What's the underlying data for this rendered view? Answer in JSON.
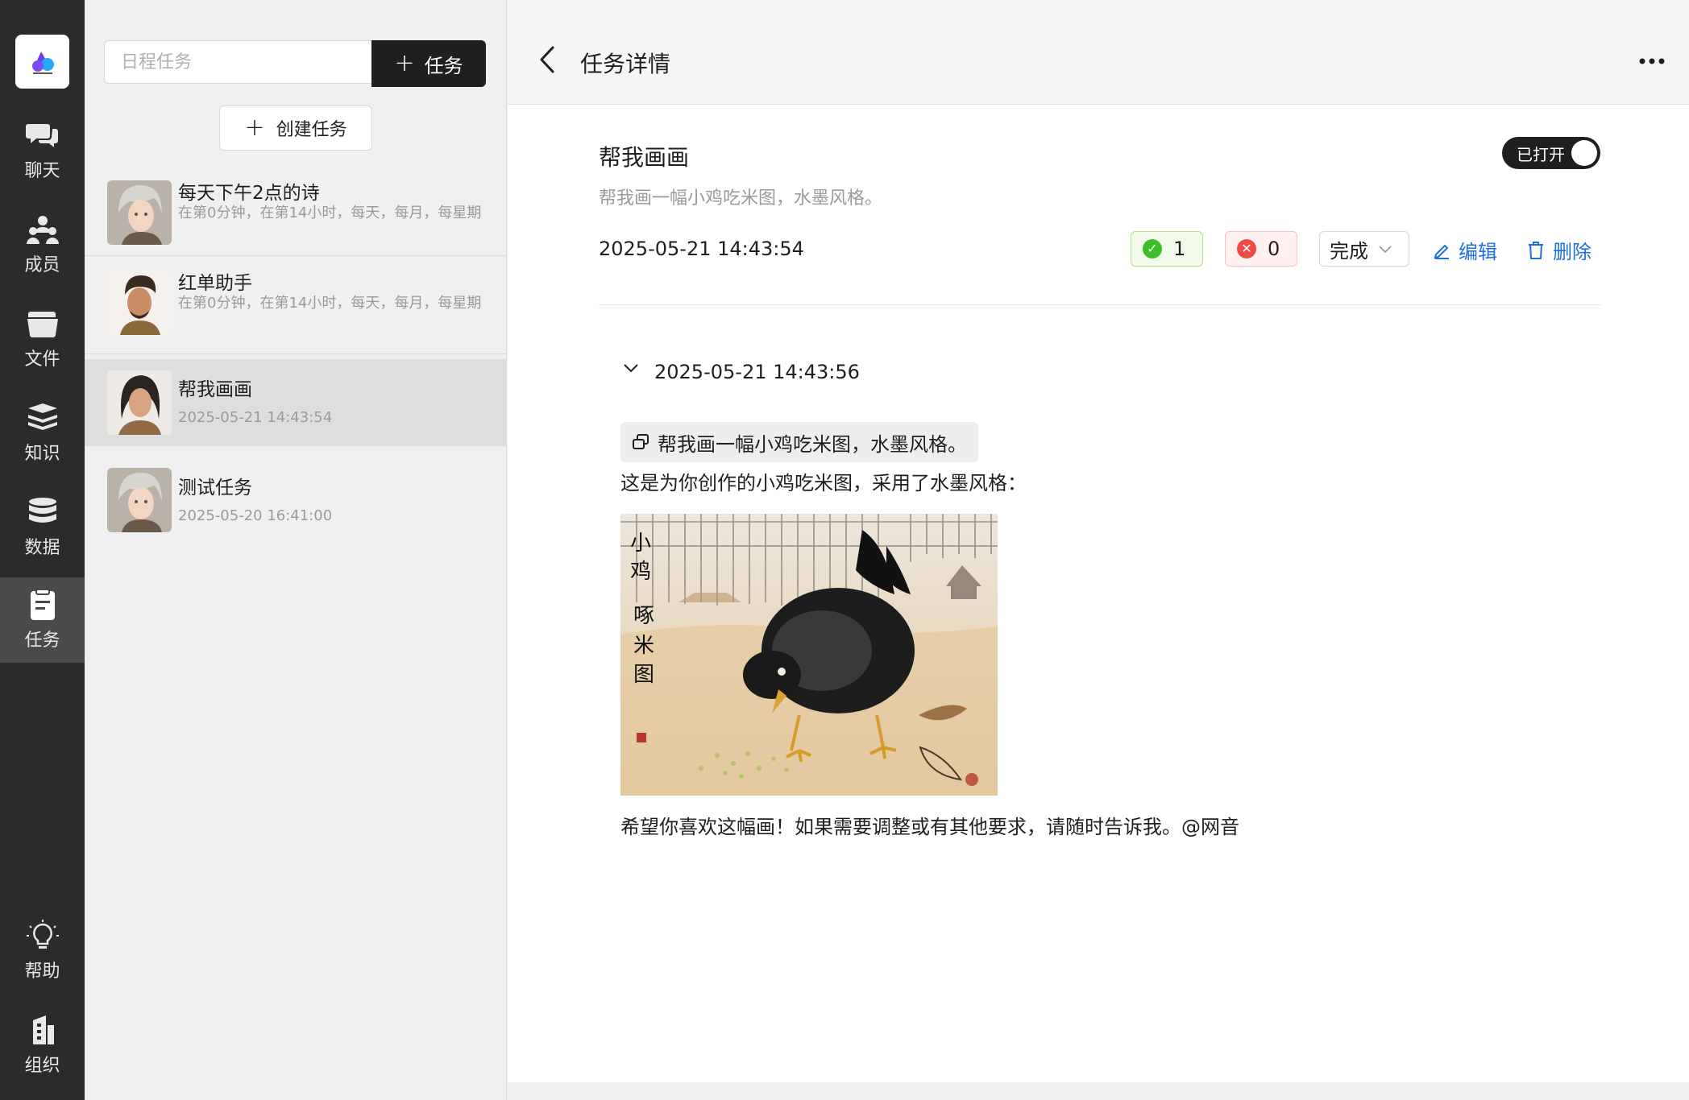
{
  "nav": {
    "items": [
      {
        "label": "聊天",
        "icon": "chat-icon"
      },
      {
        "label": "成员",
        "icon": "members-icon"
      },
      {
        "label": "文件",
        "icon": "folder-icon"
      },
      {
        "label": "知识",
        "icon": "knowledge-icon"
      },
      {
        "label": "数据",
        "icon": "database-icon"
      },
      {
        "label": "任务",
        "icon": "task-icon",
        "active": true
      },
      {
        "label": "帮助",
        "icon": "lightbulb-icon"
      },
      {
        "label": "组织",
        "icon": "organization-icon"
      }
    ]
  },
  "list": {
    "search_placeholder": "日程任务",
    "add_task_label": "任务",
    "create_task_label": "创建任务",
    "tasks": [
      {
        "title": "每天下午2点的诗",
        "subtitle": "在第0分钟，在第14小时，每天，每月，每星期"
      },
      {
        "title": "红单助手",
        "subtitle": "在第0分钟，在第14小时，每天，每月，每星期"
      },
      {
        "title": "帮我画画",
        "subtitle": "2025-05-21 14:43:54",
        "active": true
      },
      {
        "title": "测试任务",
        "subtitle": "2025-05-20 16:41:00"
      }
    ]
  },
  "detail": {
    "header_title": "任务详情",
    "title": "帮我画画",
    "description": "帮我画一幅小鸡吃米图，水墨风格。",
    "toggle_label": "已打开",
    "created_at": "2025-05-21 14:43:54",
    "success_count": "1",
    "fail_count": "0",
    "status_value": "完成",
    "edit_label": "编辑",
    "delete_label": "删除",
    "run": {
      "time": "2025-05-21 14:43:56",
      "prompt": "帮我画一幅小鸡吃米图，水墨风格。",
      "reply_intro": "这是为你创作的小鸡吃米图，采用了水墨风格：",
      "artwork_caption": "小鸡啄米图",
      "reply_outro": "希望你喜欢这幅画！如果需要调整或有其他要求，请随时告诉我。@网音"
    }
  },
  "colors": {
    "nav_bg": "#2b2b2b",
    "accent_link": "#1e6fe0",
    "success": "#3cbf2b",
    "fail": "#f04a45"
  }
}
